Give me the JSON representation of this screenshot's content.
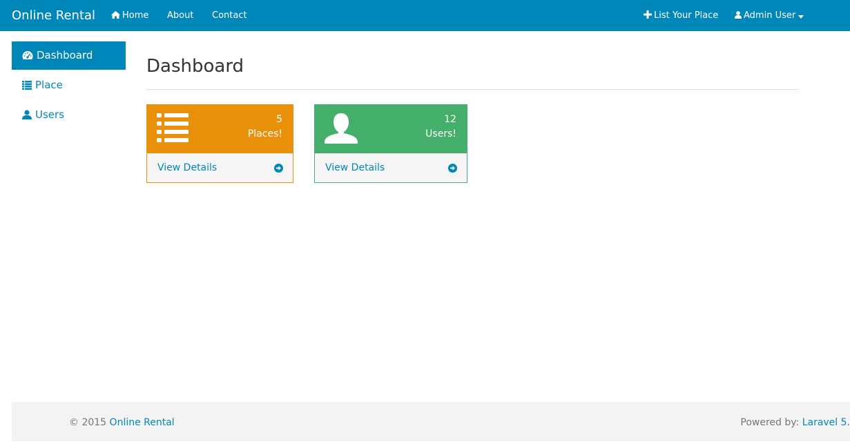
{
  "navbar": {
    "brand": "Online Rental",
    "home": "Home",
    "about": "About",
    "contact": "Contact",
    "list_place": "List Your Place",
    "user_menu": "Admin User"
  },
  "sidebar": {
    "items": [
      {
        "label": "Dashboard",
        "icon": "dashboard-icon",
        "active": true
      },
      {
        "label": "Place",
        "icon": "list-icon",
        "active": false
      },
      {
        "label": "Users",
        "icon": "user-icon",
        "active": false
      }
    ]
  },
  "main": {
    "title": "Dashboard",
    "panels": [
      {
        "count": "5",
        "label": "Places!",
        "link": "View Details",
        "icon": "list-icon",
        "color": "#e8900a"
      },
      {
        "count": "12",
        "label": "Users!",
        "link": "View Details",
        "icon": "user-icon",
        "color": "#44ae6b"
      }
    ]
  },
  "footer": {
    "copyright": "© 2015",
    "site_link": "Online Rental",
    "powered_by": "Powered by:",
    "framework_link": "Laravel 5."
  },
  "colors": {
    "primary": "#0087b9",
    "orange": "#e8900a",
    "green": "#44ae6b"
  }
}
